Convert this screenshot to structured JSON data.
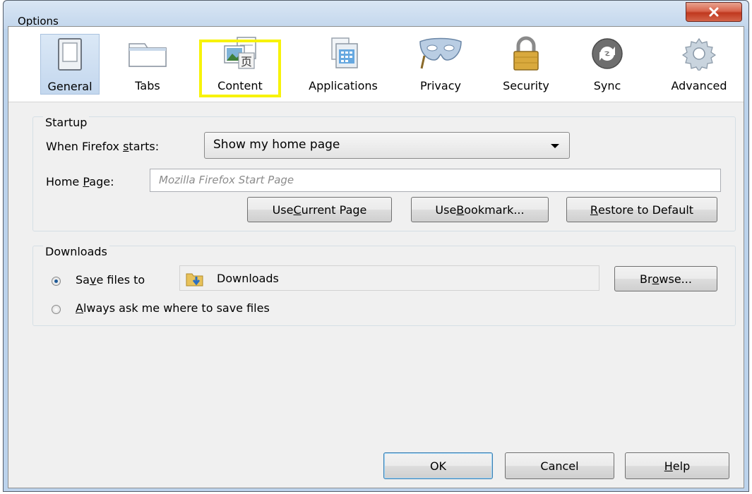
{
  "window": {
    "title": "Options",
    "close_label": "close"
  },
  "toolbar": {
    "panes": [
      {
        "id": "general",
        "label": "General",
        "icon": "toggle-switch-icon",
        "selected": true
      },
      {
        "id": "tabs",
        "label": "Tabs",
        "icon": "tabs-icon",
        "selected": false
      },
      {
        "id": "content",
        "label": "Content",
        "icon": "content-icon",
        "selected": false,
        "highlighted": true
      },
      {
        "id": "applications",
        "label": "Applications",
        "icon": "applications-icon",
        "selected": false
      },
      {
        "id": "privacy",
        "label": "Privacy",
        "icon": "mask-icon",
        "selected": false
      },
      {
        "id": "security",
        "label": "Security",
        "icon": "padlock-icon",
        "selected": false
      },
      {
        "id": "sync",
        "label": "Sync",
        "icon": "sync-icon",
        "selected": false
      },
      {
        "id": "advanced",
        "label": "Advanced",
        "icon": "gear-icon",
        "selected": false
      }
    ],
    "highlight_color": "#f7f30a"
  },
  "startup": {
    "caption": "Startup",
    "when_starts_label_pre": "When Firefox ",
    "when_starts_label_u": "s",
    "when_starts_label_post": "tarts:",
    "when_starts_value": "Show my home page",
    "home_page_label_pre": "Home ",
    "home_page_label_u": "P",
    "home_page_label_post": "age:",
    "home_page_placeholder": "Mozilla Firefox Start Page",
    "use_current_pre": "Use ",
    "use_current_u": "C",
    "use_current_post": "urrent Page",
    "use_bookmark_pre": "Use ",
    "use_bookmark_u": "B",
    "use_bookmark_post": "ookmark...",
    "restore_pre": "",
    "restore_u": "R",
    "restore_post": "estore to Default"
  },
  "downloads": {
    "caption": "Downloads",
    "save_files_pre": "Sa",
    "save_files_u": "v",
    "save_files_post": "e files to",
    "save_files_checked": true,
    "folder_name": "Downloads",
    "browse_pre": "Br",
    "browse_u": "o",
    "browse_post": "wse...",
    "always_ask_pre": "",
    "always_ask_u": "A",
    "always_ask_post": "lways ask me where to save files",
    "always_ask_checked": false
  },
  "footer": {
    "ok": "OK",
    "cancel": "Cancel",
    "help_pre": "",
    "help_u": "H",
    "help_post": "elp"
  }
}
